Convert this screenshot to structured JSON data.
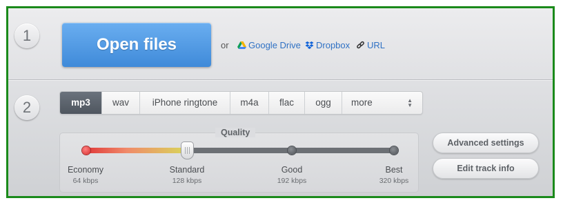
{
  "steps": {
    "one": "1",
    "two": "2"
  },
  "open": {
    "label": "Open files",
    "or": "or"
  },
  "sources": {
    "google_drive": "Google Drive",
    "dropbox": "Dropbox",
    "url": "URL"
  },
  "formats": {
    "items": [
      "mp3",
      "wav",
      "iPhone ringtone",
      "m4a",
      "flac",
      "ogg",
      "more"
    ],
    "selected": "mp3"
  },
  "quality": {
    "title": "Quality",
    "selected_index": 1,
    "levels": [
      {
        "name": "Economy",
        "kbps": "64 kbps"
      },
      {
        "name": "Standard",
        "kbps": "128 kbps"
      },
      {
        "name": "Good",
        "kbps": "192 kbps"
      },
      {
        "name": "Best",
        "kbps": "320 kbps"
      }
    ]
  },
  "buttons": {
    "advanced": "Advanced settings",
    "edit_track": "Edit track info"
  },
  "colors": {
    "frame": "#1a8a1a",
    "accent": "#3f8ad9",
    "link": "#2f71c4"
  },
  "icons": {
    "google_drive": "google-drive-icon",
    "dropbox": "dropbox-icon",
    "url": "link-icon",
    "more": "updown-arrows-icon"
  }
}
